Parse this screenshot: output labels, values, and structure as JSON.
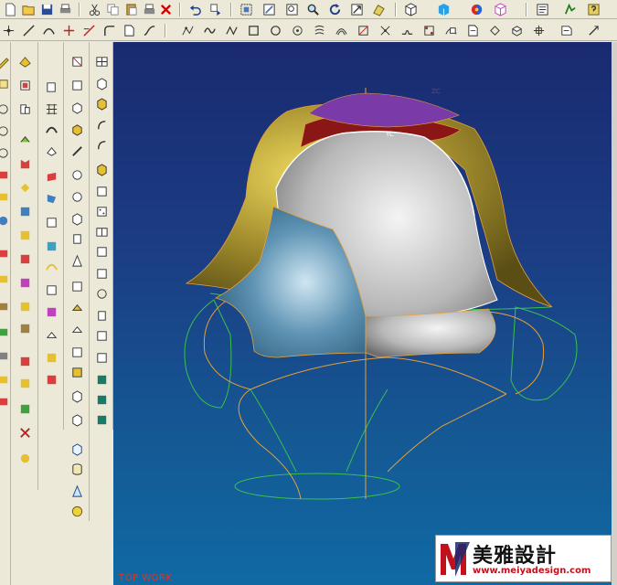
{
  "viewport": {
    "work_label": "TOP WORK",
    "axis_zc": "ZC",
    "axis_yc": "YC",
    "background_top": "#1a2a70",
    "background_bottom": "#0f6aa4"
  },
  "watermark": {
    "brand_cn": "美雅設計",
    "url": "www.meiyadesign.com"
  },
  "colors": {
    "surface_olive": "#9c8a28",
    "surface_silver": "#c8c8c8",
    "surface_blue": "#5f94b4",
    "surface_red": "#8a1616",
    "surface_purple": "#7a3aa8",
    "curve_orange": "#e8a03a",
    "curve_green": "#39c24a"
  },
  "toolbar_top": [
    "open-icon",
    "save-icon",
    "print-icon",
    "cut-icon",
    "copy-icon",
    "paste-icon",
    "delete-icon",
    "undo-icon",
    "redo-icon",
    "fit-icon",
    "zoom-region-icon",
    "zoom-icon",
    "rotate-icon",
    "pan-icon",
    "view-icon",
    "render-icon",
    "color-icon",
    "layer-icon",
    "info-icon",
    "analysis-icon",
    "help-icon"
  ],
  "toolbar_curve": [
    "point-icon",
    "line-icon",
    "arc-icon",
    "chamfer-icon",
    "spline-icon",
    "rectangle-icon",
    "polygon-icon",
    "circle-icon",
    "ellipse-icon",
    "helix-icon",
    "offset-icon",
    "trim-icon",
    "project-icon",
    "bridge-icon",
    "extract-icon",
    "join-icon",
    "split-icon",
    "edit-icon"
  ]
}
